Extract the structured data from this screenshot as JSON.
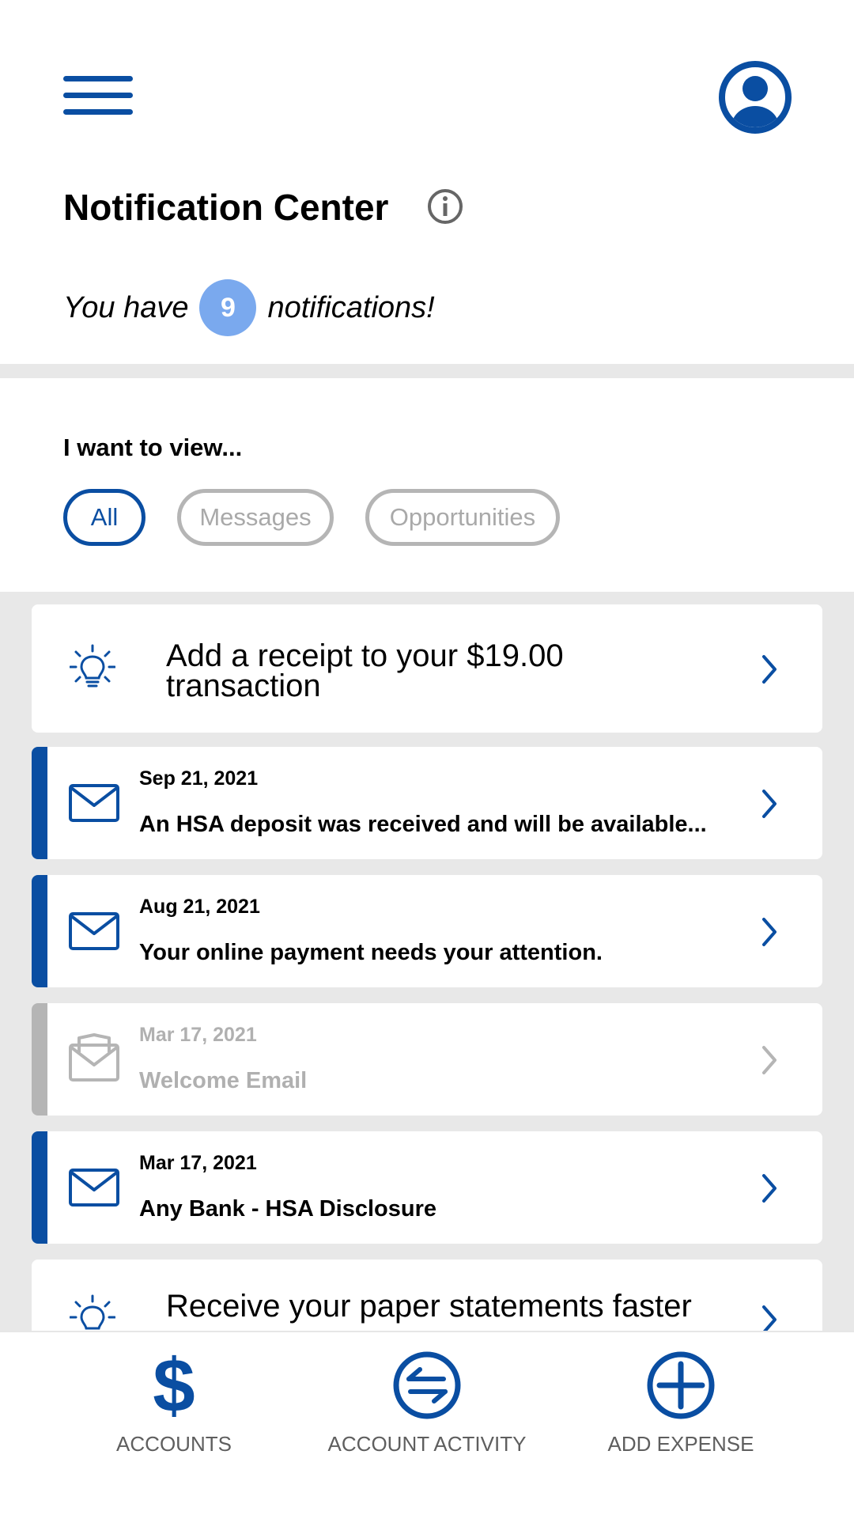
{
  "header": {
    "menu_icon": "hamburger-menu-icon",
    "profile_icon": "user-profile-icon",
    "title": "Notification Center",
    "info_icon": "info-icon"
  },
  "summary": {
    "prefix": "You have",
    "count": "9",
    "suffix": "notifications!"
  },
  "filter": {
    "label": "I want to view...",
    "chips": [
      "All",
      "Messages",
      "Opportunities"
    ],
    "selected": "All"
  },
  "notifications": [
    {
      "type": "opportunity",
      "icon": "lightbulb-icon",
      "text_line1": "Add a receipt to your $19.00",
      "text_line2": "transaction"
    },
    {
      "type": "message",
      "status": "unread",
      "icon": "envelope-icon",
      "date": "Sep 21, 2021",
      "subject": "An HSA deposit was received and will be available..."
    },
    {
      "type": "message",
      "status": "unread",
      "icon": "envelope-icon",
      "date": "Aug 21, 2021",
      "subject": "Your online payment needs your attention."
    },
    {
      "type": "message",
      "status": "read",
      "icon": "open-envelope-icon",
      "date": "Mar 17, 2021",
      "subject": "Welcome Email"
    },
    {
      "type": "message",
      "status": "unread",
      "icon": "envelope-icon",
      "date": "Mar 17, 2021",
      "subject": "Any Bank - HSA Disclosure"
    },
    {
      "type": "opportunity",
      "icon": "lightbulb-icon",
      "text_line1": "Receive your paper statements faster"
    }
  ],
  "bottom_nav": [
    {
      "label": "ACCOUNTS",
      "icon": "dollar-icon"
    },
    {
      "label": "ACCOUNT ACTIVITY",
      "icon": "transfer-arrows-icon"
    },
    {
      "label": "ADD EXPENSE",
      "icon": "plus-circle-icon"
    }
  ],
  "colors": {
    "primary": "#0a4ea2",
    "badge": "#7aa9ee",
    "read_gray": "#b5b5b5",
    "list_background": "#e8e8e8"
  }
}
